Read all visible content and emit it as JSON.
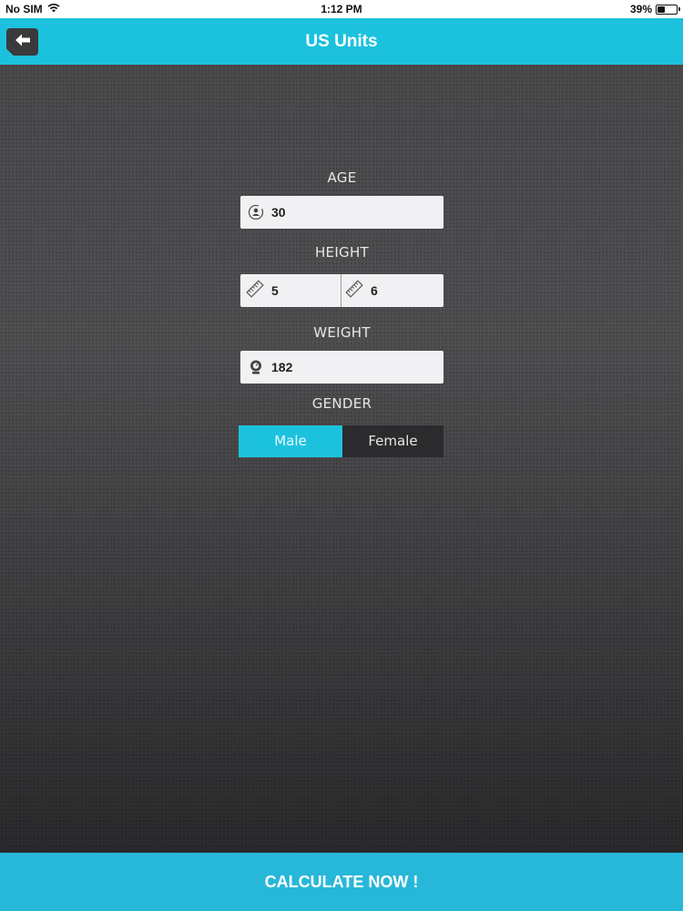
{
  "status_bar": {
    "carrier": "No SIM",
    "time": "1:12 PM",
    "battery_text": "39%",
    "battery_level": 0.39
  },
  "nav": {
    "title": "US Units"
  },
  "form": {
    "age": {
      "label": "AGE",
      "value": "30"
    },
    "height": {
      "label": "HEIGHT",
      "feet": "5",
      "inches": "6"
    },
    "weight": {
      "label": "WEIGHT",
      "value": "182"
    },
    "gender": {
      "label": "GENDER",
      "options": [
        "Male",
        "Female"
      ],
      "selected": "Male"
    }
  },
  "actions": {
    "calculate_label": "CALCULATE NOW !"
  },
  "colors": {
    "accent": "#1cc2dd",
    "button": "#27b7d9"
  }
}
